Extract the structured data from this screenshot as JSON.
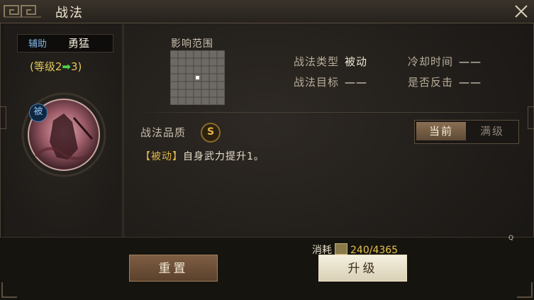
{
  "window": {
    "title": "战法"
  },
  "skill": {
    "tag": "辅助",
    "name": "勇猛",
    "level_prefix": "(等级2",
    "level_arrow": "➡",
    "level_suffix": "3)",
    "portrait_badge": "被"
  },
  "range": {
    "label": "影响范围",
    "rows": 7,
    "cols": 7,
    "highlight_cell": [
      3,
      3
    ]
  },
  "info": {
    "type_label": "战法类型",
    "type_value": "被动",
    "cooldown_label": "冷却时间",
    "cooldown_value": "——",
    "target_label": "战法目标",
    "target_value": "——",
    "counter_label": "是否反击",
    "counter_value": "——"
  },
  "quality": {
    "label": "战法品质",
    "grade": "S"
  },
  "tabs": {
    "current": "当前",
    "max": "满级"
  },
  "description": {
    "tag": "【被动】",
    "text": "自身武力提升1。"
  },
  "cost": {
    "label": "消耗",
    "value": "240/4365"
  },
  "buttons": {
    "reset": "重置",
    "upgrade": "升级"
  },
  "misc": {
    "q_marker": "Q"
  },
  "colors": {
    "accent_gold": "#e8c24a",
    "level_green": "#4ed14e",
    "tag_blue": "#7fb5e8"
  }
}
